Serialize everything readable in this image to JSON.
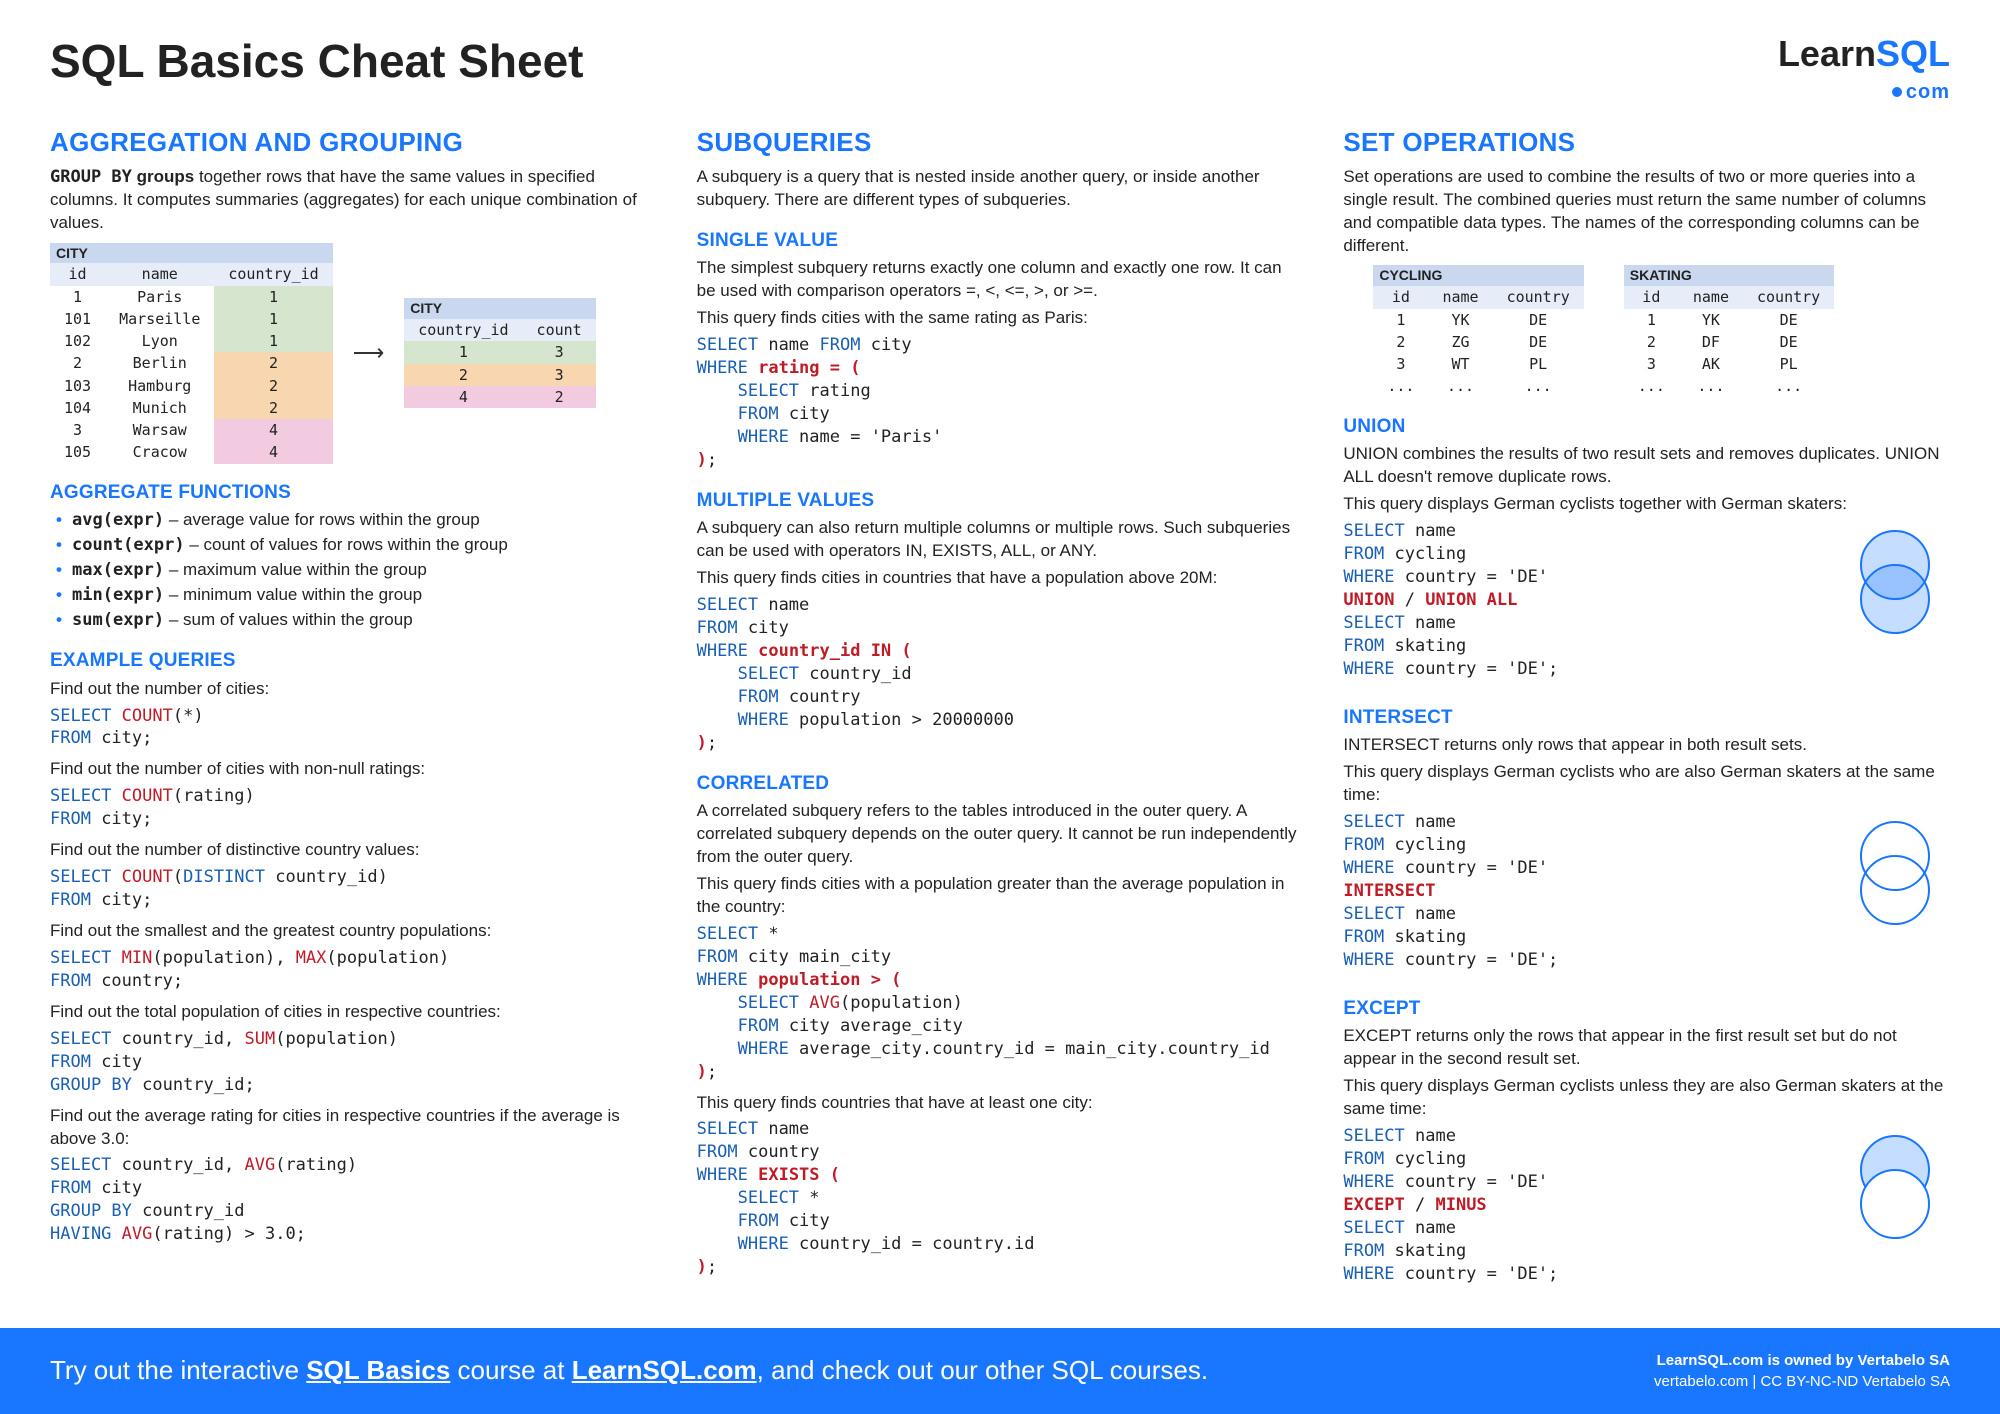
{
  "title": "SQL Basics Cheat Sheet",
  "logo": {
    "learn": "Learn",
    "sql": "SQL",
    "dotcom": "com"
  },
  "col1": {
    "heading": "AGGREGATION AND GROUPING",
    "intro1": "GROUP BY",
    "intro2": " groups",
    "intro3": " together rows that have the same values in specified columns. It computes summaries (aggregates) for each unique combination of values.",
    "table_city": {
      "name": "CITY",
      "headers": [
        "id",
        "name",
        "country_id"
      ],
      "rows": [
        [
          "1",
          "Paris",
          "1"
        ],
        [
          "101",
          "Marseille",
          "1"
        ],
        [
          "102",
          "Lyon",
          "1"
        ],
        [
          "2",
          "Berlin",
          "2"
        ],
        [
          "103",
          "Hamburg",
          "2"
        ],
        [
          "104",
          "Munich",
          "2"
        ],
        [
          "3",
          "Warsaw",
          "4"
        ],
        [
          "105",
          "Cracow",
          "4"
        ]
      ],
      "row_classes": [
        "c1",
        "c1",
        "c1",
        "c2",
        "c2",
        "c2",
        "c4",
        "c4"
      ]
    },
    "table_agg": {
      "name": "CITY",
      "headers": [
        "country_id",
        "count"
      ],
      "rows": [
        [
          "1",
          "3"
        ],
        [
          "2",
          "3"
        ],
        [
          "4",
          "2"
        ]
      ],
      "row_classes": [
        "c1",
        "c2",
        "c4"
      ]
    },
    "agg_heading": "AGGREGATE FUNCTIONS",
    "agg_list": [
      {
        "f": "avg(",
        "a": "expr)",
        "d": " – average value for rows within the group"
      },
      {
        "f": "count(",
        "a": "expr)",
        "d": " – count of values for rows within the group"
      },
      {
        "f": "max(",
        "a": "expr)",
        "d": " – maximum value within the group"
      },
      {
        "f": "min(",
        "a": "expr)",
        "d": " – minimum value within the group"
      },
      {
        "f": "sum(",
        "a": "expr)",
        "d": " – sum of values within the group"
      }
    ],
    "ex_heading": "EXAMPLE QUERIES",
    "q1": {
      "t": "Find out the number of cities:",
      "c": "SELECT COUNT(*)\nFROM city;"
    },
    "q2": {
      "t": "Find out the number of cities with non-null ratings:",
      "c": "SELECT COUNT(rating)\nFROM city;"
    },
    "q3": {
      "t": "Find out the number of distinctive country values:",
      "c": "SELECT COUNT(DISTINCT country_id)\nFROM city;"
    },
    "q4": {
      "t": "Find out the smallest and the greatest country populations:",
      "c": "SELECT MIN(population), MAX(population)\nFROM country;"
    },
    "q5": {
      "t": "Find out the total population of cities in respective countries:",
      "c": "SELECT country_id, SUM(population)\nFROM city\nGROUP BY country_id;"
    },
    "q6": {
      "t": "Find out the average rating for cities in respective countries if the average is above 3.0:",
      "c": "SELECT country_id, AVG(rating)\nFROM city\nGROUP BY country_id\nHAVING AVG(rating) > 3.0;"
    }
  },
  "col2": {
    "heading": "SUBQUERIES",
    "intro": "A subquery is a query that is nested inside another query, or inside another subquery. There are different types of subqueries.",
    "sv_heading": "SINGLE VALUE",
    "sv_text": "The simplest subquery returns exactly one column and exactly one row. It can be used with comparison operators =, <, <=, >, or >=.",
    "sv_q": "This query finds cities with the same rating as Paris:",
    "sv_code": "SELECT name FROM city\nWHERE rating = (\n    SELECT rating\n    FROM city\n    WHERE name = 'Paris'\n);",
    "mv_heading": "MULTIPLE VALUES",
    "mv_text": "A subquery can also return multiple columns or multiple rows. Such subqueries can be used with operators IN, EXISTS, ALL, or ANY.",
    "mv_q": "This query finds cities in countries that have a population above 20M:",
    "mv_code": "SELECT name\nFROM city\nWHERE country_id IN (\n    SELECT country_id\n    FROM country\n    WHERE population > 20000000\n);",
    "cor_heading": "CORRELATED",
    "cor_text": "A correlated subquery refers to the tables introduced in the outer query. A correlated subquery depends on the outer query. It cannot be run independently from the outer query.",
    "cor_q1": "This query finds cities with a population greater than the average population in the country:",
    "cor_code1": "SELECT *\nFROM city main_city\nWHERE population > (\n    SELECT AVG(population)\n    FROM city average_city\n    WHERE average_city.country_id = main_city.country_id\n);",
    "cor_q2": "This query finds countries that have at least one city:",
    "cor_code2": "SELECT name\nFROM country\nWHERE EXISTS (\n    SELECT *\n    FROM city\n    WHERE country_id = country.id\n);"
  },
  "col3": {
    "heading": "SET OPERATIONS",
    "intro": "Set operations are used to combine the results of two or more queries into a single result. The combined queries must return the same number of columns and compatible data types. The names of the corresponding columns can be different.",
    "cycling": {
      "name": "CYCLING",
      "headers": [
        "id",
        "name",
        "country"
      ],
      "rows": [
        [
          "1",
          "YK",
          "DE"
        ],
        [
          "2",
          "ZG",
          "DE"
        ],
        [
          "3",
          "WT",
          "PL"
        ],
        [
          "...",
          "...",
          "..."
        ]
      ]
    },
    "skating": {
      "name": "SKATING",
      "headers": [
        "id",
        "name",
        "country"
      ],
      "rows": [
        [
          "1",
          "YK",
          "DE"
        ],
        [
          "2",
          "DF",
          "DE"
        ],
        [
          "3",
          "AK",
          "PL"
        ],
        [
          "...",
          "...",
          "..."
        ]
      ]
    },
    "union_heading": "UNION",
    "union_text": "UNION combines the results of two result sets and removes duplicates. UNION ALL doesn't remove duplicate rows.",
    "union_q": "This query displays German cyclists together with German skaters:",
    "union_code": "SELECT name\nFROM cycling\nWHERE country = 'DE'\nUNION / UNION ALL\nSELECT name\nFROM skating\nWHERE country = 'DE';",
    "int_heading": "INTERSECT",
    "int_text": "INTERSECT returns only rows that appear in both result sets.",
    "int_q": "This query displays German cyclists who are also German skaters at the same time:",
    "int_code": "SELECT name\nFROM cycling\nWHERE country = 'DE'\nINTERSECT\nSELECT name\nFROM skating\nWHERE country = 'DE';",
    "exc_heading": "EXCEPT",
    "exc_text": "EXCEPT returns only the rows that appear in the first result set but do not appear in the second result set.",
    "exc_q": "This query displays German cyclists unless they are also German skaters at the same time:",
    "exc_code": "SELECT name\nFROM cycling\nWHERE country = 'DE'\nEXCEPT / MINUS\nSELECT name\nFROM skating\nWHERE country = 'DE';"
  },
  "footer": {
    "left1": "Try out the interactive ",
    "left2": "SQL Basics",
    "left3": " course at ",
    "left4": "LearnSQL.com",
    "left5": ", and check out our other SQL courses.",
    "right1": "LearnSQL.com is owned by Vertabelo SA",
    "right2": "vertabelo.com | CC BY-NC-ND Vertabelo SA"
  }
}
